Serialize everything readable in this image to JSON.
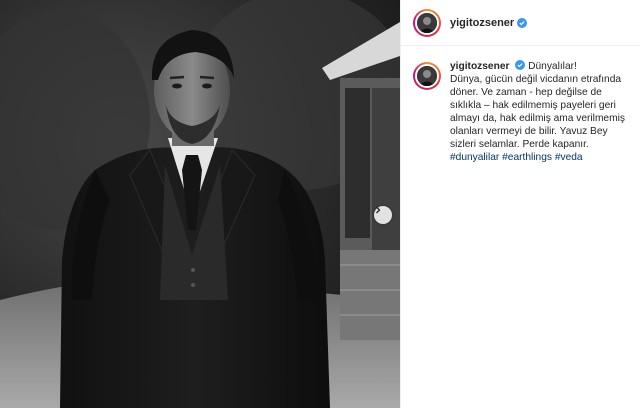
{
  "post": {
    "username": "yigitozsener",
    "verified": true,
    "caption_title": "Dünyalılar!",
    "caption_lines": [
      "Dünya, gücün değil vicdanın etrafında",
      "döner. Ve zaman - hep değilse de",
      "sıklıkla – hak edilmemiş payeleri geri",
      "almayı da, hak edilmiş ama verilmemiş",
      "olanları vermeyi de bilir. Yavuz Bey",
      "sizleri selamlar. Perde kapanır."
    ],
    "hashtags": [
      "#dunyalilar",
      "#earthlings",
      "#veda"
    ]
  },
  "colors": {
    "link": "#00376b",
    "verified": "#3897f0",
    "border": "#efefef"
  },
  "icons": {
    "next": "chevron-right-icon",
    "verified": "verified-badge-icon"
  }
}
